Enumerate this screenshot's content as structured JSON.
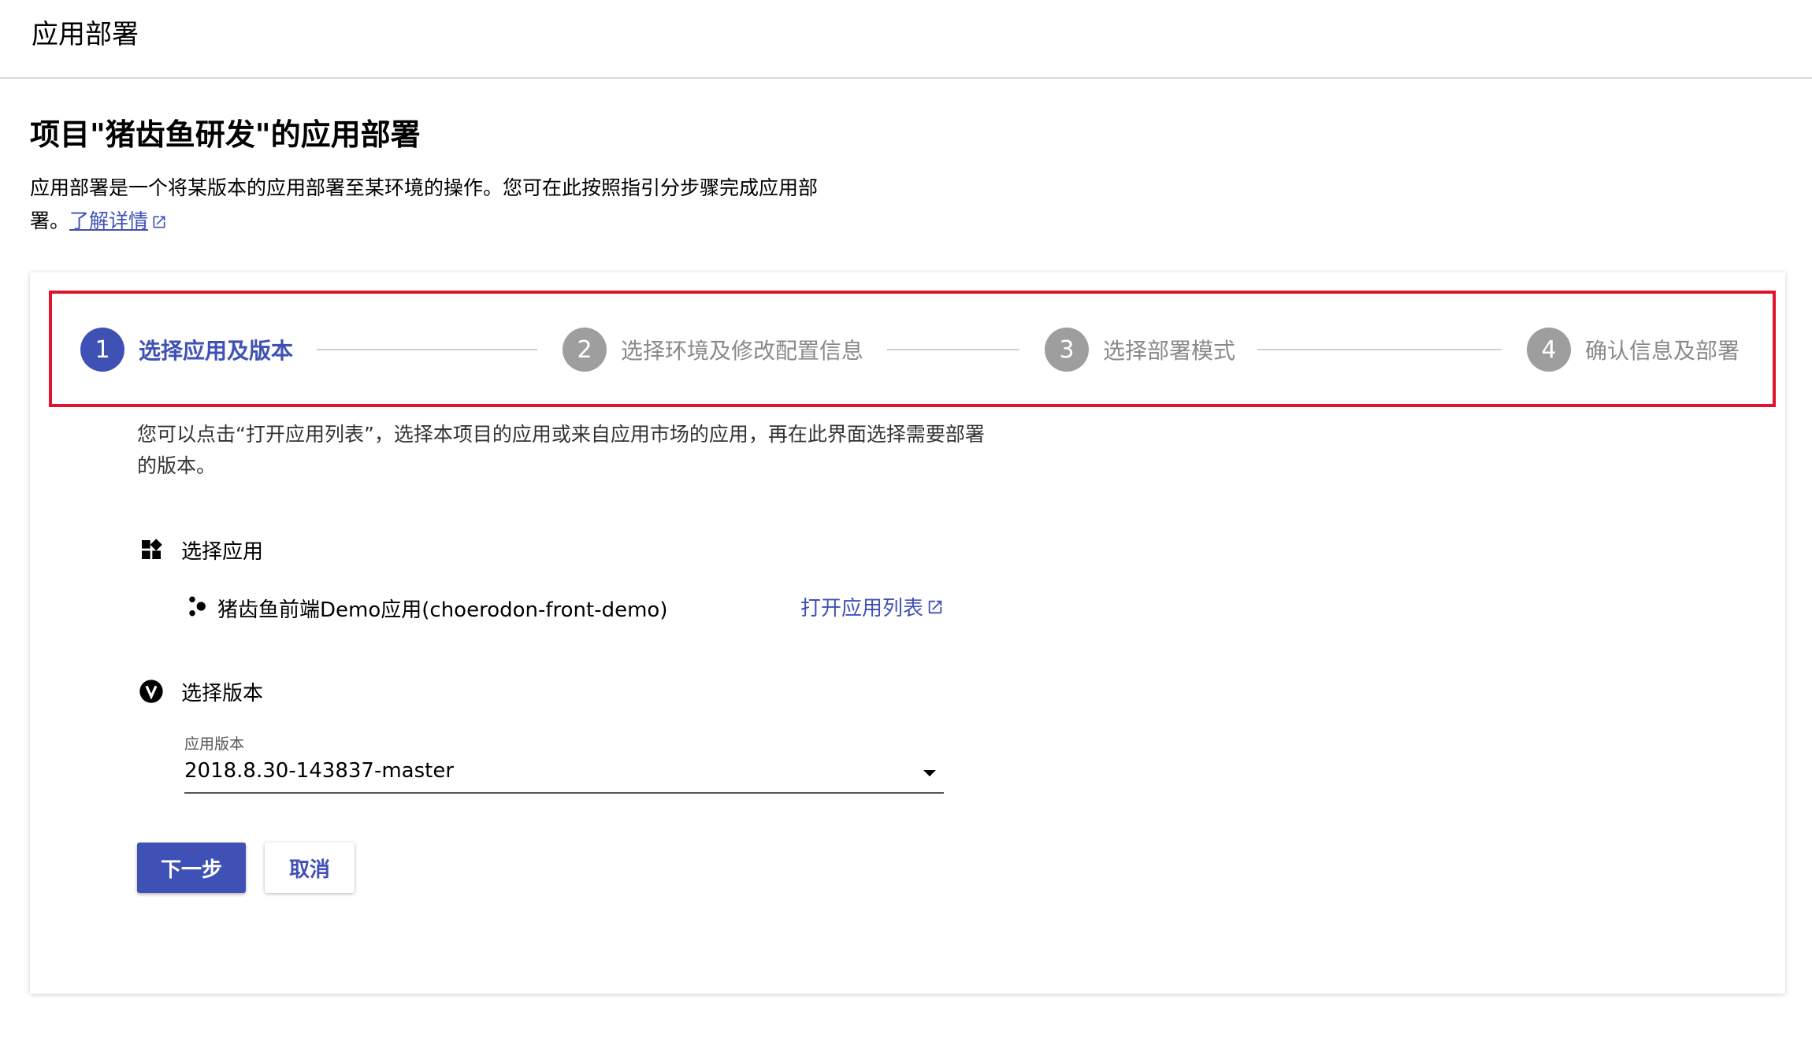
{
  "header": {
    "title": "应用部署"
  },
  "page": {
    "title": "项目\"猪齿鱼研发\"的应用部署",
    "description": "应用部署是一个将某版本的应用部署至某环境的操作。您可在此按照指引分步骤完成应用部署。",
    "learn_more": "了解详情"
  },
  "stepper": {
    "steps": [
      {
        "number": "1",
        "label": "选择应用及版本"
      },
      {
        "number": "2",
        "label": "选择环境及修改配置信息"
      },
      {
        "number": "3",
        "label": "选择部署模式"
      },
      {
        "number": "4",
        "label": "确认信息及部署"
      }
    ],
    "active_step": 1
  },
  "step1": {
    "hint": "您可以点击“打开应用列表”，选择本项目的应用或来自应用市场的应用，再在此界面选择需要部署的版本。",
    "select_app": {
      "label": "选择应用",
      "app_name": "猪齿鱼前端Demo应用(choerodon-front-demo)",
      "open_list": "打开应用列表"
    },
    "select_version": {
      "label": "选择版本",
      "field_label": "应用版本",
      "value": "2018.8.30-143837-master"
    }
  },
  "actions": {
    "next": "下一步",
    "cancel": "取消"
  },
  "colors": {
    "primary": "#3f51b5",
    "highlight": "#e0152d",
    "inactive": "#9e9e9e"
  }
}
